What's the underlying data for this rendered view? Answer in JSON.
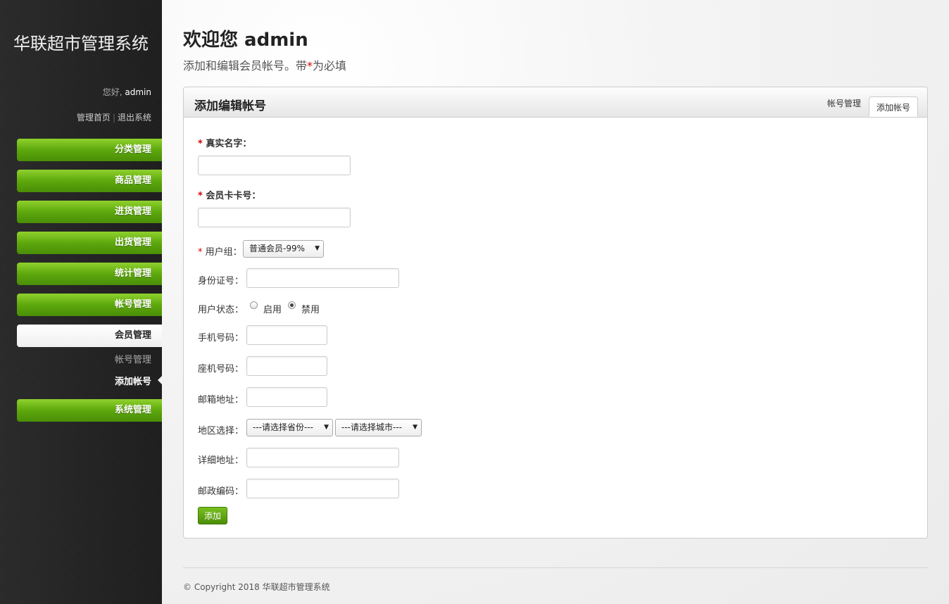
{
  "sidebar": {
    "brand": "华联超市管理系统",
    "greeting": "您好,",
    "username": "admin",
    "home_link": "管理首页",
    "separator": "|",
    "logout_link": "退出系统",
    "nav": [
      {
        "label": "分类管理"
      },
      {
        "label": "商品管理"
      },
      {
        "label": "进货管理"
      },
      {
        "label": "出货管理"
      },
      {
        "label": "统计管理"
      },
      {
        "label": "帐号管理"
      },
      {
        "label": "会员管理"
      },
      {
        "label": "系统管理"
      }
    ],
    "sub_nav": [
      {
        "label": "帐号管理"
      },
      {
        "label": "添加帐号"
      }
    ]
  },
  "header": {
    "title": "欢迎您 admin",
    "subtitle_before": "添加和编辑会员帐号。带",
    "subtitle_star": "*",
    "subtitle_after": "为必填"
  },
  "panel": {
    "title": "添加编辑帐号",
    "tabs": [
      {
        "label": "帐号管理"
      },
      {
        "label": "添加帐号"
      }
    ]
  },
  "form": {
    "required_mark": "*",
    "real_name_label": "真实名字：",
    "real_name_value": "",
    "card_no_label": "会员卡卡号：",
    "card_no_value": "",
    "group_label": "用户组：",
    "group_selected": "普通会员-99%",
    "id_card_label": "身份证号：",
    "id_card_value": "",
    "status_label": "用户状态：",
    "status_options": [
      "启用",
      "禁用"
    ],
    "status_selected": "禁用",
    "mobile_label": "手机号码：",
    "mobile_value": "",
    "phone_label": "座机号码：",
    "phone_value": "",
    "email_label": "邮箱地址：",
    "email_value": "",
    "region_label": "地区选择：",
    "province_selected": "---请选择省份---",
    "city_selected": "---请选择城市---",
    "address_label": "详细地址：",
    "address_value": "",
    "zip_label": "邮政编码：",
    "zip_value": "",
    "submit_label": "添加"
  },
  "footer": {
    "text": "© Copyright 2018 华联超市管理系统"
  },
  "colors": {
    "nav_green": "#5da80d",
    "required_red": "#d60000",
    "sidebar_bg": "#222222"
  }
}
